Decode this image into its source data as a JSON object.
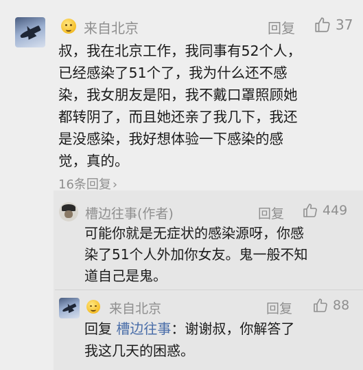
{
  "main_comment": {
    "location": "来自北京",
    "reply_label": "回复",
    "likes": "37",
    "lines": [
      "叔，我在北京工作，我同事有52个人，",
      "已经感染了51个了，我为什么还不感",
      "染，我女朋友是阳，我不戴口罩照顾她",
      "都转阴了，而且她还亲了我几下，我还",
      "是没感染，我好想体验一下感染的感",
      "觉，真的。"
    ],
    "sub_reply_count": "16条回复"
  },
  "reply_author": {
    "name": "槽边往事(作者)",
    "reply_label": "回复",
    "likes": "449",
    "lines": [
      "可能你就是无症状的感染源呀，你感",
      "染了51个人外加你女友。鬼一般不知",
      "道自己是鬼。"
    ]
  },
  "reply_user": {
    "location": "来自北京",
    "reply_label": "回复",
    "likes": "88",
    "reply_prefix": "回复",
    "mention": "槽边往事",
    "line1_rest": "：谢谢叔，你解答了",
    "line2": "我这几天的困惑。"
  }
}
